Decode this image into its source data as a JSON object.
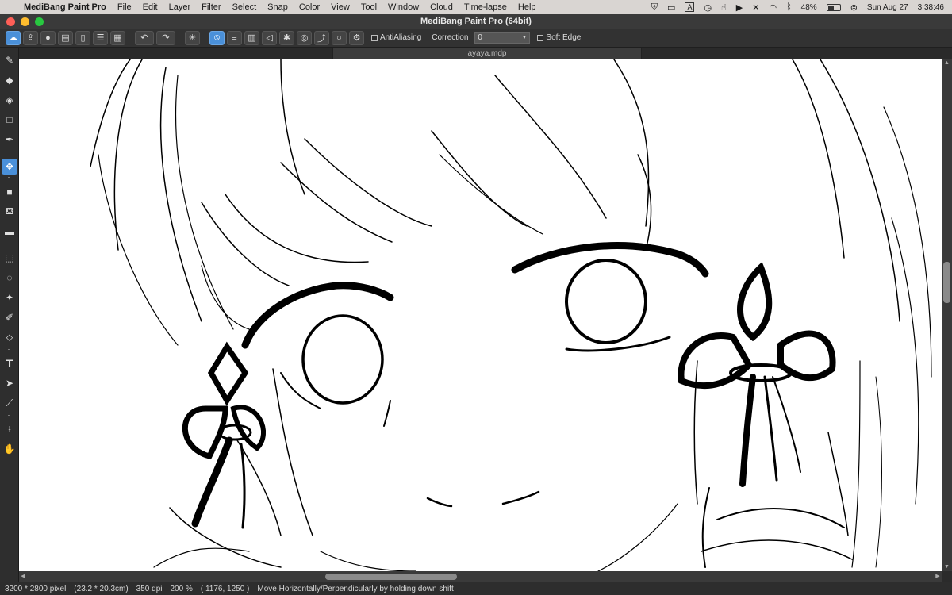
{
  "menubar": {
    "app_name": "MediBang Paint Pro",
    "items": [
      "File",
      "Edit",
      "Layer",
      "Filter",
      "Select",
      "Snap",
      "Color",
      "View",
      "Tool",
      "Window",
      "Cloud",
      "Time-lapse",
      "Help"
    ],
    "input_indicator": "A",
    "battery_percent": "48%",
    "battery_level": 0.48,
    "date": "Sun Aug 27",
    "time": "3:38:46"
  },
  "window": {
    "title": "MediBang Paint Pro (64bit)"
  },
  "toolbar": {
    "antialiasing_label": "AntiAliasing",
    "correction_label": "Correction",
    "correction_value": "0",
    "soft_edge_label": "Soft Edge"
  },
  "document": {
    "tab_name": "ayaya.mdp"
  },
  "tools": [
    {
      "name": "brush-tool",
      "icon": "brush-icon"
    },
    {
      "name": "eraser-tool",
      "icon": "eraser-icon"
    },
    {
      "name": "dot-eraser-tool",
      "icon": "dot-eraser-icon"
    },
    {
      "name": "rectangle-tool",
      "icon": "rectangle-icon"
    },
    {
      "name": "pen-tool",
      "icon": "pen-icon"
    },
    {
      "name": "move-tool",
      "icon": "move-icon"
    },
    {
      "name": "fill-rect-tool",
      "icon": "filled-square-icon"
    },
    {
      "name": "bucket-tool",
      "icon": "bucket-icon"
    },
    {
      "name": "gradient-tool",
      "icon": "gradient-icon"
    },
    {
      "name": "select-tool",
      "icon": "select-rect-icon"
    },
    {
      "name": "lasso-tool",
      "icon": "lasso-icon"
    },
    {
      "name": "magic-wand-tool",
      "icon": "magic-wand-icon"
    },
    {
      "name": "select-pen-tool",
      "icon": "select-pen-icon"
    },
    {
      "name": "select-eraser-tool",
      "icon": "select-eraser-icon"
    },
    {
      "name": "text-tool",
      "icon": "text-icon"
    },
    {
      "name": "operation-tool",
      "icon": "cursor-icon"
    },
    {
      "name": "divide-tool",
      "icon": "divide-icon"
    },
    {
      "name": "eyedropper-tool",
      "icon": "eyedropper-icon"
    },
    {
      "name": "hand-tool",
      "icon": "hand-icon"
    }
  ],
  "statusbar": {
    "pixel_size": "3200 * 2800 pixel",
    "cm_size": "(23.2 * 20.3cm)",
    "dpi": "350 dpi",
    "zoom": "200 %",
    "coords": "( 1176, 1250 )",
    "hint": "Move Horizontally/Perpendicularly by holding down shift"
  },
  "colors": {
    "accent": "#4a90d9",
    "close": "#ff5f57",
    "minimize": "#febc2e",
    "zoom": "#28c840"
  }
}
